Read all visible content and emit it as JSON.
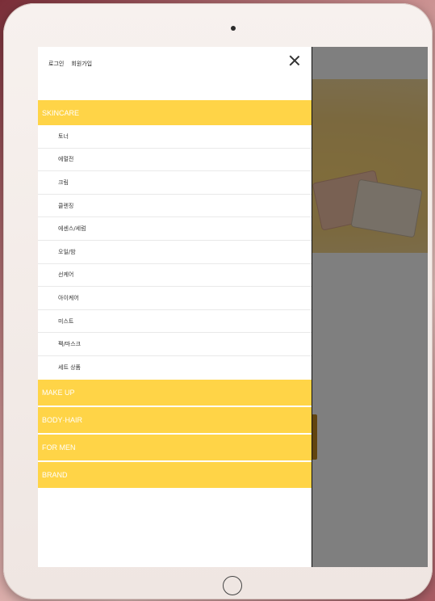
{
  "drawer": {
    "auth": {
      "login": "로그인",
      "signup": "회원가입"
    },
    "close_label": "×",
    "categories": [
      {
        "label": "SKINCARE",
        "expanded": true,
        "items": [
          "토너",
          "에멀전",
          "크림",
          "클렌징",
          "에센스/세럼",
          "오일/밤",
          "선케어",
          "아이케어",
          "미스트",
          "팩/마스크",
          "세트 상품"
        ]
      },
      {
        "label": "MAKE UP",
        "expanded": false
      },
      {
        "label": "BODY·HAIR",
        "expanded": false
      },
      {
        "label": "FOR MEN",
        "expanded": false
      },
      {
        "label": "BRAND",
        "expanded": false
      }
    ]
  },
  "colors": {
    "category_bg": "#ffd447",
    "overlay": "rgba(0,0,0,0.5)"
  }
}
